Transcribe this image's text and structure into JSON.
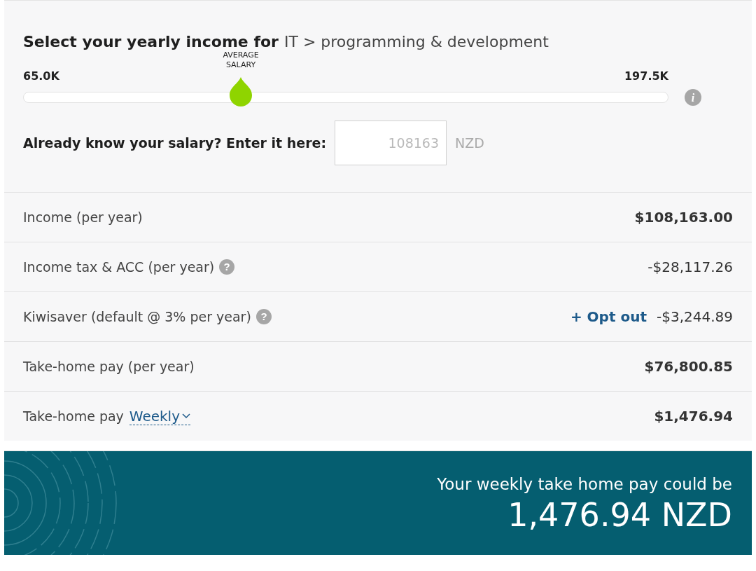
{
  "heading": {
    "title": "Select your yearly income for",
    "category": "IT > programming & development"
  },
  "slider": {
    "min_label": "65.0K",
    "max_label": "197.5K",
    "marker_label": "AVERAGE SALARY",
    "level": 0.337,
    "info_icon": "i"
  },
  "salary_input": {
    "label": "Already know your salary? Enter it here:",
    "placeholder": "108163",
    "unit": "NZD"
  },
  "rows": [
    {
      "kind": "plain",
      "label": "Income (per year)",
      "value": "$108,163.00",
      "emphasized": true
    },
    {
      "kind": "plain",
      "label": "Income tax & ACC (per year)",
      "help_icon": "?",
      "value": "-$28,117.26",
      "emphasized": false
    },
    {
      "kind": "link",
      "label": "Kiwisaver (default @ 3% per year)",
      "help_icon": "?",
      "link": "+ Opt out",
      "value": "-$3,244.89",
      "emphasized": false
    },
    {
      "kind": "plain",
      "label": "Take-home pay (per year)",
      "value": "$76,800.85",
      "emphasized": true
    },
    {
      "kind": "dropdown",
      "label": "Take-home pay",
      "dropdown": "Weekly",
      "value": "$1,476.94",
      "emphasized": true
    }
  ],
  "banner": {
    "caption": "Your weekly take home pay could be",
    "amount": "1,476.94 NZD"
  }
}
